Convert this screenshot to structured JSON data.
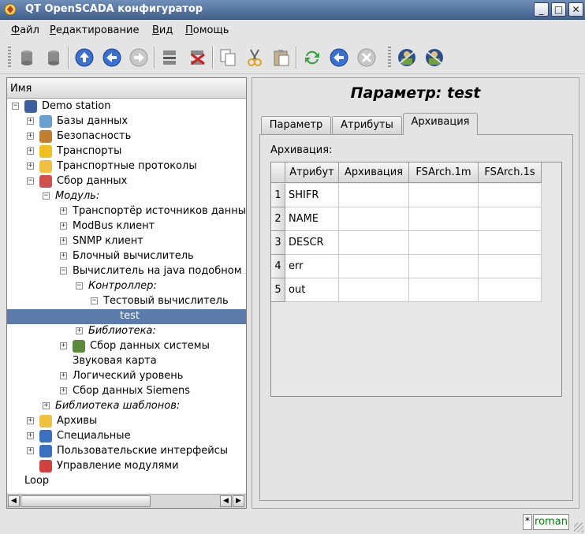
{
  "window": {
    "title": "QT OpenSCADA конфигуратор",
    "buttons": [
      "_",
      "□",
      "✕"
    ]
  },
  "menu": [
    {
      "label": "Файл",
      "u": "Ф",
      "rest": "айл"
    },
    {
      "label": "Редактирование",
      "u": "Р",
      "rest": "едактирование"
    },
    {
      "label": "Вид",
      "u": "В",
      "rest": "ид"
    },
    {
      "label": "Помощь",
      "u": "П",
      "rest": "омощь"
    }
  ],
  "toolbar": {
    "icons": [
      "db-load-icon",
      "db-save-icon",
      "up-icon",
      "back-icon",
      "forward-icon",
      "add-item-icon",
      "delete-item-icon",
      "copy-icon",
      "cut-icon",
      "paste-icon",
      "refresh-icon",
      "start-icon",
      "stop-icon",
      "user-icon-1",
      "user-icon-2"
    ]
  },
  "tree": {
    "header": "Имя",
    "items": [
      {
        "label": "Demo station",
        "level": 0,
        "exp": "-",
        "icon": "station-icon",
        "color": "#3c5fa0"
      },
      {
        "label": "Базы данных",
        "level": 1,
        "exp": "+",
        "icon": "database-icon",
        "color": "#6a9fd0"
      },
      {
        "label": "Безопасность",
        "level": 1,
        "exp": "+",
        "icon": "security-icon",
        "color": "#c08030"
      },
      {
        "label": "Транспорты",
        "level": 1,
        "exp": "+",
        "icon": "lightning-icon",
        "color": "#f0c020"
      },
      {
        "label": "Транспортные протоколы",
        "level": 1,
        "exp": "+",
        "icon": "folder-icon",
        "color": "#f0c040"
      },
      {
        "label": "Сбор данных",
        "level": 1,
        "exp": "-",
        "icon": "chart-icon",
        "color": "#d05050"
      },
      {
        "label": "Модуль:",
        "level": 2,
        "exp": "-",
        "italic": true
      },
      {
        "label": "Транспортёр источников данны",
        "level": 3,
        "exp": "+"
      },
      {
        "label": "ModBus клиент",
        "level": 3,
        "exp": "+"
      },
      {
        "label": "SNMP клиент",
        "level": 3,
        "exp": "+"
      },
      {
        "label": "Блочный вычислитель",
        "level": 3,
        "exp": "+"
      },
      {
        "label": "Вычислитель на java подобном я",
        "level": 3,
        "exp": "-"
      },
      {
        "label": "Контроллер:",
        "level": 4,
        "exp": "-",
        "italic": true
      },
      {
        "label": "Тестовый вычислитель",
        "level": 5,
        "exp": "-"
      },
      {
        "label": "test",
        "level": 6,
        "exp": "",
        "selected": true
      },
      {
        "label": "Библиотека:",
        "level": 4,
        "exp": "+",
        "italic": true
      },
      {
        "label": "Сбор данных системы",
        "level": 3,
        "exp": "+",
        "icon": "system-icon",
        "color": "#5a8a3a"
      },
      {
        "label": "Звуковая карта",
        "level": 3,
        "exp": ""
      },
      {
        "label": "Логический уровень",
        "level": 3,
        "exp": "+"
      },
      {
        "label": "Сбор данных Siemens",
        "level": 3,
        "exp": "+"
      },
      {
        "label": "Библиотека шаблонов:",
        "level": 2,
        "exp": "+",
        "italic": true
      },
      {
        "label": "Архивы",
        "level": 1,
        "exp": "+",
        "icon": "archive-icon",
        "color": "#f0c040"
      },
      {
        "label": "Специальные",
        "level": 1,
        "exp": "+",
        "icon": "help-icon",
        "color": "#3a70c0"
      },
      {
        "label": "Пользовательские интерфейсы",
        "level": 1,
        "exp": "+",
        "icon": "monitor-icon",
        "color": "#3a70c0"
      },
      {
        "label": "Управление модулями",
        "level": 1,
        "exp": "",
        "icon": "modules-icon",
        "color": "#d04040"
      },
      {
        "label": "Loop",
        "level": 0,
        "exp": ""
      }
    ]
  },
  "main": {
    "title": "Параметр: test",
    "tabs": [
      "Параметр",
      "Атрибуты",
      "Архивация"
    ],
    "active_tab": 2,
    "section_label": "Архивация:",
    "table": {
      "columns": [
        "Атрибут",
        "Архивация",
        "FSArch.1m",
        "FSArch.1s"
      ],
      "rows": [
        [
          "1",
          "SHIFR",
          "",
          "",
          ""
        ],
        [
          "2",
          "NAME",
          "",
          "",
          ""
        ],
        [
          "3",
          "DESCR",
          "",
          "",
          ""
        ],
        [
          "4",
          "err",
          "",
          "",
          ""
        ],
        [
          "5",
          "out",
          "",
          "",
          ""
        ]
      ]
    }
  },
  "status": {
    "modified": "*",
    "user": "roman"
  }
}
